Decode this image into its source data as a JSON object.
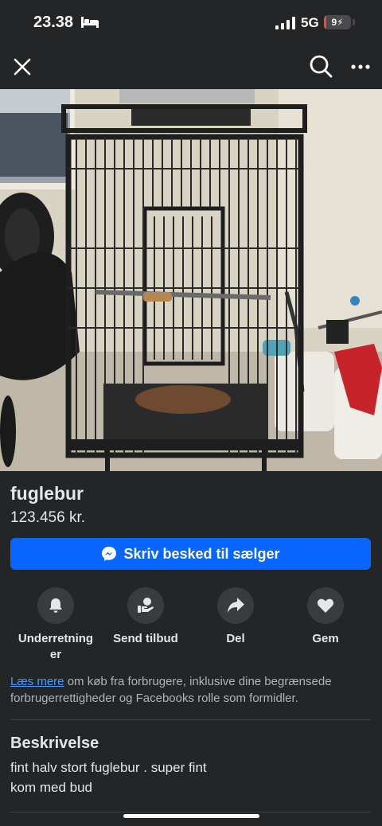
{
  "status_bar": {
    "time": "23.38",
    "network": "5G",
    "battery_text": "9",
    "battery_level": 0.09
  },
  "nav": {
    "close_icon": "close-icon",
    "search_icon": "search-icon",
    "more_icon": "more-icon"
  },
  "listing": {
    "title": "fuglebur",
    "price": "123.456 kr.",
    "message_button": "Skriv besked til sælger"
  },
  "actions": [
    {
      "label": "Underretning er",
      "line1": "Underretning",
      "line2": "er",
      "icon": "bell-icon"
    },
    {
      "label": "Send tilbud",
      "icon": "offer-icon"
    },
    {
      "label": "Del",
      "icon": "share-icon"
    },
    {
      "label": "Gem",
      "icon": "heart-icon"
    }
  ],
  "notice": {
    "link_text": "Læs mere",
    "text": " om køb fra forbrugere, inklusive dine begrænsede forbrugerrettigheder og Facebooks rolle som formidler."
  },
  "description": {
    "heading": "Beskrivelse",
    "lines": [
      "fint halv stort fuglebur .  super fint",
      "kom med bud"
    ]
  },
  "colors": {
    "background": "#242526",
    "accent": "#0866ff",
    "link": "#4599ff",
    "battery_low": "#eb4d3d"
  }
}
